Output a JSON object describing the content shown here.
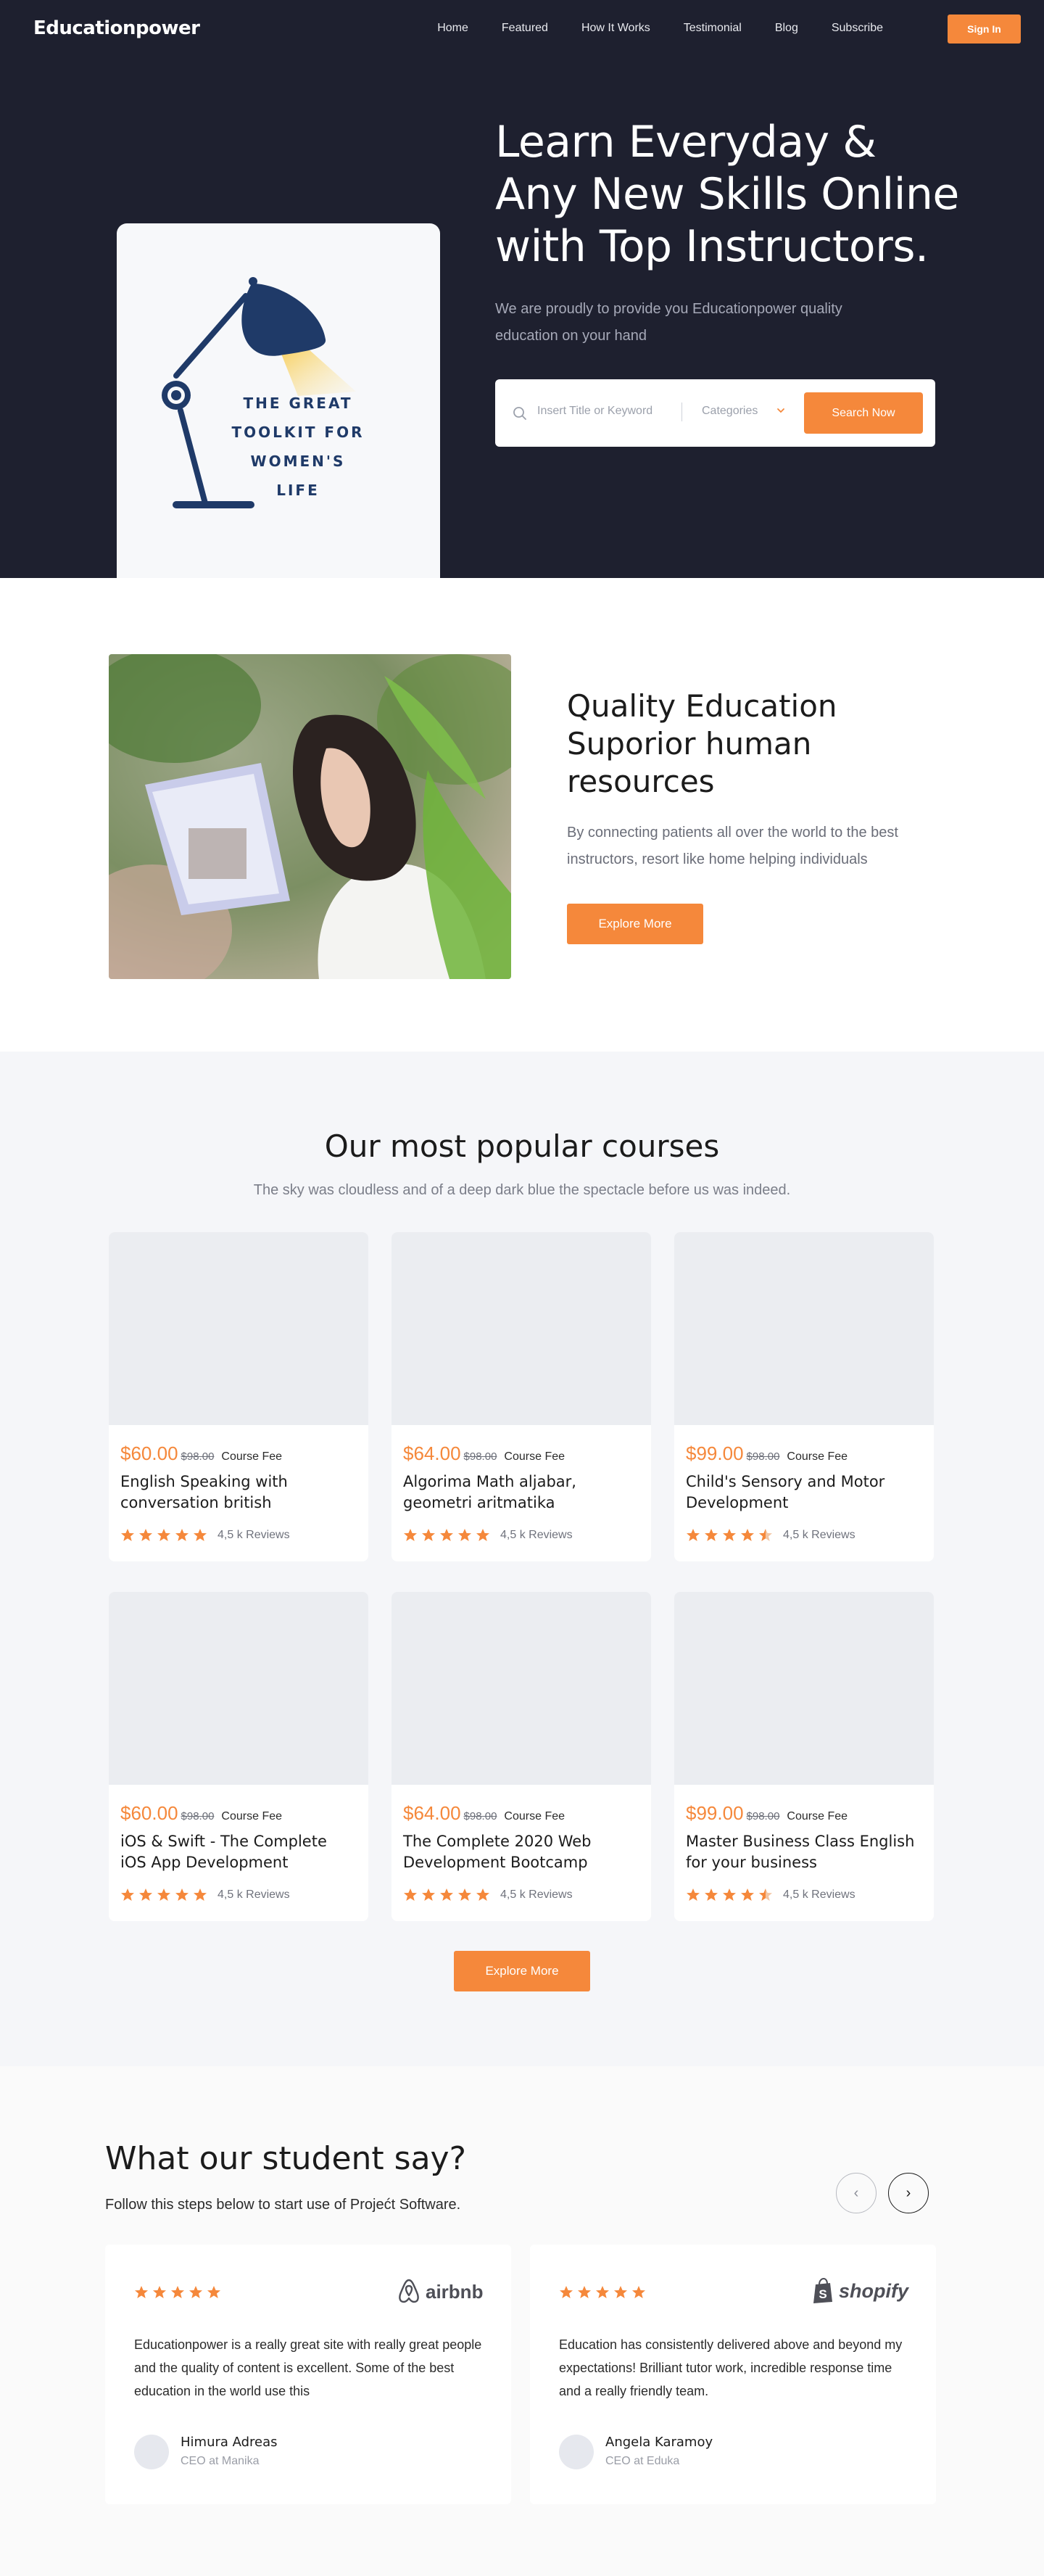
{
  "header": {
    "logo": "Educationpower",
    "nav": [
      "Home",
      "Featured",
      "How It Works",
      "Testimonial",
      "Blog",
      "Subscribe"
    ],
    "signin_label": "Sign In"
  },
  "hero": {
    "card_text": [
      "THE GREAT",
      "TOOLKIT FOR",
      "WOMEN'S",
      "LIFE"
    ],
    "title": "Learn Everyday & Any New Skills Online with Top Instructors.",
    "subtitle": "We are proudly to provide you Educationpower quality education on your hand",
    "search": {
      "placeholder": "Insert Title or Keyword",
      "category_label": "Categories",
      "button_label": "Search Now"
    }
  },
  "quality": {
    "title": "Quality Education Suporior human resources",
    "text": "By connecting patients all over the world to the best instructors, resort like home helping individuals",
    "button_label": "Explore More"
  },
  "courses": {
    "title": "Our most popular courses",
    "subtitle": "The sky was cloudless and of a deep dark blue the spectacle before us was indeed.",
    "fee_label": "Course Fee",
    "items": [
      {
        "price": "$60.00",
        "old_price": "$98.00",
        "title": "English Speaking with conversation british",
        "rating": 5,
        "reviews": "4,5 k Reviews"
      },
      {
        "price": "$64.00",
        "old_price": "$98.00",
        "title": "Algorima Math aljabar, geometri aritmatika",
        "rating": 5,
        "reviews": "4,5 k Reviews"
      },
      {
        "price": "$99.00",
        "old_price": "$98.00",
        "title": "Child's Sensory and Motor Development",
        "rating": 4.5,
        "reviews": "4,5 k Reviews"
      },
      {
        "price": "$60.00",
        "old_price": "$98.00",
        "title": "iOS & Swift - The Complete iOS App Development",
        "rating": 5,
        "reviews": "4,5 k Reviews"
      },
      {
        "price": "$64.00",
        "old_price": "$98.00",
        "title": "The Complete 2020 Web Development Bootcamp",
        "rating": 5,
        "reviews": "4,5 k Reviews"
      },
      {
        "price": "$99.00",
        "old_price": "$98.00",
        "title": "Master Business Class English for your business",
        "rating": 4.5,
        "reviews": "4,5 k Reviews"
      }
    ],
    "button_label": "Explore More"
  },
  "testimonials": {
    "title": "What our student say?",
    "subtitle": "Follow this steps below to start use of Projećt Software.",
    "prev_icon": "‹",
    "next_icon": "›",
    "items": [
      {
        "brand": "airbnb",
        "rating": 5,
        "quote": "Educationpower is a really great site with really great people and the quality of content is excellent. Some of the best education in the world use this",
        "name": "Himura Adreas",
        "role": "CEO at Manika"
      },
      {
        "brand": "shopify",
        "rating": 5,
        "quote": "Education has consistently delivered above and beyond my expectations! Brilliant tutor work, incredible response time and a really friendly team.",
        "name": "Angela Karamoy",
        "role": "CEO at Eduka"
      }
    ]
  },
  "colors": {
    "accent": "#f5883b",
    "hero_bg": "#1e202f",
    "courses_bg": "#f5f6f9",
    "lamp_navy": "#1f3a68"
  }
}
